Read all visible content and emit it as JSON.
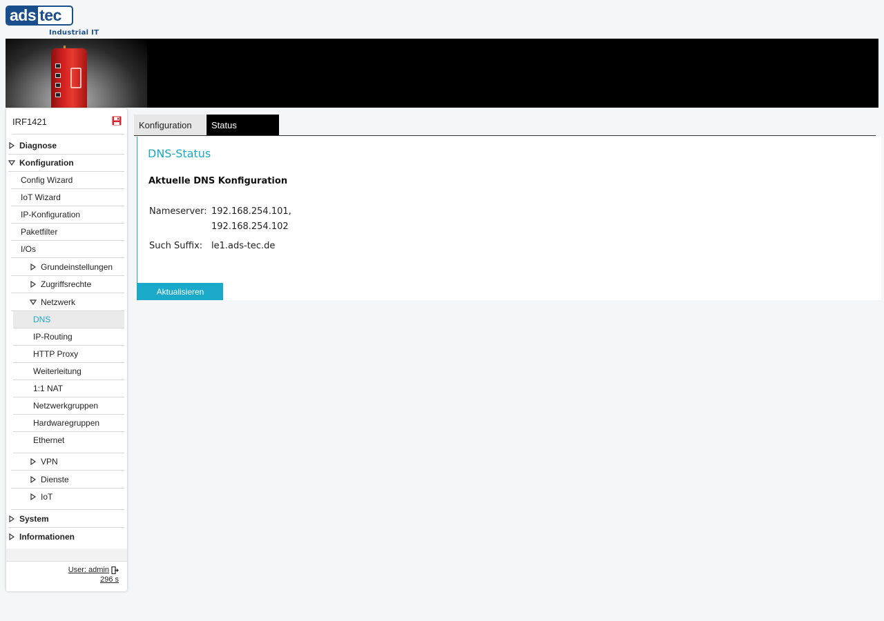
{
  "brand": {
    "logo_left": "ads",
    "logo_right": "tec",
    "tagline": "Industrial IT"
  },
  "device": {
    "name": "IRF1421"
  },
  "icons": {
    "save": "save-icon",
    "logout": "logout-icon"
  },
  "colors": {
    "accent": "#1aa9c8",
    "brand": "#1a4d8c",
    "save_icon": "#d9232e"
  },
  "sidebar": {
    "diagnose": "Diagnose",
    "konfiguration": "Konfiguration",
    "config_wizard": "Config Wizard",
    "iot_wizard": "IoT Wizard",
    "ip_konfiguration": "IP-Konfiguration",
    "paketfilter": "Paketfilter",
    "ios": "I/Os",
    "grundeinstellungen": "Grundeinstellungen",
    "zugriffsrechte": "Zugriffsrechte",
    "netzwerk": "Netzwerk",
    "dns": "DNS",
    "ip_routing": "IP-Routing",
    "http_proxy": "HTTP Proxy",
    "weiterleitung": "Weiterleitung",
    "nat": "1:1 NAT",
    "netzwerkgruppen": "Netzwerkgruppen",
    "hardwaregruppen": "Hardwaregruppen",
    "ethernet": "Ethernet",
    "vpn": "VPN",
    "dienste": "Dienste",
    "iot": "IoT",
    "system": "System",
    "informationen": "Informationen"
  },
  "footer": {
    "user": "User: admin",
    "timer": "296 s"
  },
  "tabs": {
    "konfiguration": "Konfiguration",
    "status": "Status"
  },
  "main": {
    "title": "DNS-Status",
    "section": "Aktuelle DNS Konfiguration",
    "nameserver_label": "Nameserver:",
    "nameserver_value_1": "192.168.254.101,",
    "nameserver_value_2": "192.168.254.102",
    "suffix_label": "Such Suffix:",
    "suffix_value": "le1.ads-tec.de",
    "refresh_button": "Aktualisieren"
  }
}
